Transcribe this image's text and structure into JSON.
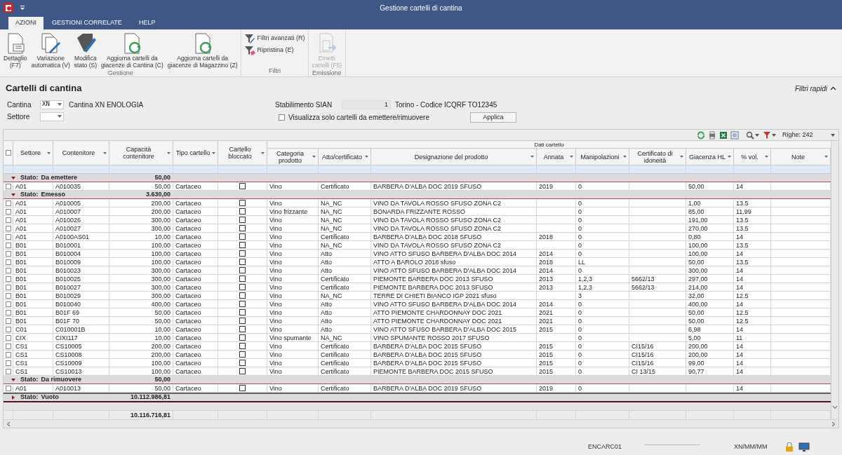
{
  "window": {
    "title": "Gestione cartelli di cantina"
  },
  "ribbon_tabs": [
    {
      "label": "AZIONI",
      "selected": true
    },
    {
      "label": "GESTIONI CORRELATE",
      "selected": false
    },
    {
      "label": "HELP",
      "selected": false
    }
  ],
  "ribbon_groups": [
    {
      "label": "Gestione",
      "buttons": [
        {
          "kind": "large",
          "label": "Dettaglio\n(F7)",
          "disabled": false
        },
        {
          "kind": "large",
          "label": "Variazione\nautomatica (V)",
          "disabled": false
        },
        {
          "kind": "large",
          "label": "Modifica\nstato (S)",
          "disabled": false
        },
        {
          "kind": "large",
          "label": "Aggiorna cartelli da\ngiacenze di Cantina (C)",
          "disabled": false
        },
        {
          "kind": "large",
          "label": "Aggiorna cartelli da\ngiacenze di Magazzino (Z)",
          "disabled": false
        }
      ]
    },
    {
      "label": "Filtri",
      "buttons": [
        {
          "kind": "small",
          "label": "Filtri avanzati (R)",
          "disabled": false
        },
        {
          "kind": "small",
          "label": "Ripristina (E)",
          "disabled": false
        }
      ]
    },
    {
      "label": "Emissione",
      "buttons": [
        {
          "kind": "large",
          "label": "Emetti\ncartelli (F5)",
          "disabled": true
        }
      ]
    }
  ],
  "page": {
    "title": "Cartelli di cantina",
    "quick_filters": {
      "label": "Filtri rapidi",
      "expanded": true
    }
  },
  "filters": {
    "cantina": {
      "label": "Cantina",
      "value": "XN",
      "description": "Cantina XN ENOLOGIA"
    },
    "settore": {
      "label": "Settore"
    },
    "stabilimento": {
      "label": "Stabilimento SIAN",
      "value": "1",
      "description": "Torino - Codice ICQRF TO12345"
    },
    "only_pending": {
      "label": "Visualizza solo cartelli da emettere/rimuovere",
      "checked": false
    },
    "apply_button": "Applica"
  },
  "table": {
    "rows_count": "Righe: 242",
    "select_all": false,
    "group_header": "Dati cartello",
    "columns": [
      "Settore",
      "Contenitore",
      "Capacità contenitore",
      "Tipo cartello",
      "Cartello bloccato",
      "Categoria prodotto",
      "Atto/certificato",
      "Designazione del prodotto",
      "Annata",
      "Manipolazioni",
      "Certificato di idoneità",
      "Giacenza HL",
      "% vol.",
      "Note"
    ],
    "groups": [
      {
        "label": "Stato:",
        "name": "Da emettere",
        "total": "50,00",
        "expanded": true,
        "rows": [
          {
            "selected": false,
            "sector": "A01",
            "container": "A010035",
            "capacity": "50,00",
            "type": "Cartaceo",
            "locked": false,
            "category": "Vino",
            "deed": "Certificato",
            "product": "BARBERA D'ALBA DOC 2019 SFUSO",
            "vintage": "2019",
            "handling": "0",
            "stock_hl": "50,00",
            "abv": "14"
          }
        ]
      },
      {
        "label": "Stato:",
        "name": "Emesso",
        "total": "3.630,00",
        "expanded": true,
        "rows": [
          {
            "selected": false,
            "sector": "A01",
            "container": "A010005",
            "capacity": "200,00",
            "type": "Cartaceo",
            "locked": false,
            "category": "Vino",
            "deed": "NA_NC",
            "product": "VINO DA TAVOLA ROSSO SFUSO ZONA C2",
            "handling": "0",
            "stock_hl": "1,00",
            "abv": "13.5"
          },
          {
            "selected": false,
            "sector": "A01",
            "container": "A010007",
            "capacity": "200,00",
            "type": "Cartaceo",
            "locked": false,
            "category": "Vino frizzante",
            "deed": "NA_NC",
            "product": "BONARDA FRIZZANTE ROSSO",
            "handling": "0",
            "stock_hl": "85,00",
            "abv": "11.99"
          },
          {
            "selected": false,
            "sector": "A01",
            "container": "A010026",
            "capacity": "300,00",
            "type": "Cartaceo",
            "locked": false,
            "category": "Vino",
            "deed": "NA_NC",
            "product": "VINO DA TAVOLA ROSSO SFUSO ZONA C2",
            "handling": "0",
            "stock_hl": "191,00",
            "abv": "13.5"
          },
          {
            "selected": false,
            "sector": "A01",
            "container": "A010027",
            "capacity": "300,00",
            "type": "Cartaceo",
            "locked": false,
            "category": "Vino",
            "deed": "NA_NC",
            "product": "VINO DA TAVOLA ROSSO SFUSO ZONA C2",
            "handling": "0",
            "stock_hl": "270,00",
            "abv": "13.5"
          },
          {
            "selected": false,
            "sector": "A01",
            "container": "A0100AS01",
            "capacity": "10,00",
            "type": "Cartaceo",
            "locked": false,
            "category": "Vino",
            "deed": "Certificato",
            "product": "BARBERA D'ALBA DOC 2018 SFUSO",
            "vintage": "2018",
            "handling": "0",
            "stock_hl": "0,80",
            "abv": "14"
          },
          {
            "selected": false,
            "sector": "B01",
            "container": "B010001",
            "capacity": "100,00",
            "type": "Cartaceo",
            "locked": false,
            "category": "Vino",
            "deed": "NA_NC",
            "product": "VINO DA TAVOLA ROSSO SFUSO ZONA C2",
            "handling": "0",
            "stock_hl": "100,00",
            "abv": "13.5"
          },
          {
            "selected": false,
            "sector": "B01",
            "container": "B010004",
            "capacity": "100,00",
            "type": "Cartaceo",
            "locked": false,
            "category": "Vino",
            "deed": "Atto",
            "product": "VINO ATTO SFUSO BARBERA D'ALBA DOC 2014",
            "vintage": "2014",
            "handling": "0",
            "stock_hl": "100,00",
            "abv": "14"
          },
          {
            "selected": false,
            "sector": "B01",
            "container": "B010009",
            "capacity": "100,00",
            "type": "Cartaceo",
            "locked": false,
            "category": "Vino",
            "deed": "Atto",
            "product": "ATTO A BAROLO 2018 sfuso",
            "vintage": "2018",
            "handling": "LL",
            "stock_hl": "50,00",
            "abv": "13.5"
          },
          {
            "selected": false,
            "sector": "B01",
            "container": "B010023",
            "capacity": "300,00",
            "type": "Cartaceo",
            "locked": false,
            "category": "Vino",
            "deed": "Atto",
            "product": "VINO ATTO SFUSO BARBERA D'ALBA DOC 2014",
            "vintage": "2014",
            "handling": "0",
            "stock_hl": "300,00",
            "abv": "14"
          },
          {
            "selected": false,
            "sector": "B01",
            "container": "B010025",
            "capacity": "300,00",
            "type": "Cartaceo",
            "locked": false,
            "category": "Vino",
            "deed": "Certificato",
            "product": "PIEMONTE BARBERA DOC 2013 SFUSO",
            "vintage": "2013",
            "handling": "1,2,3",
            "certificate": "5662/13",
            "stock_hl": "297,00",
            "abv": "14"
          },
          {
            "selected": false,
            "sector": "B01",
            "container": "B010027",
            "capacity": "300,00",
            "type": "Cartaceo",
            "locked": false,
            "category": "Vino",
            "deed": "Certificato",
            "product": "PIEMONTE BARBERA DOC 2013 SFUSO",
            "vintage": "2013",
            "handling": "1,2,3",
            "certificate": "5662/13",
            "stock_hl": "214,00",
            "abv": "14"
          },
          {
            "selected": false,
            "sector": "B01",
            "container": "B010029",
            "capacity": "300,00",
            "type": "Cartaceo",
            "locked": false,
            "category": "Vino",
            "deed": "NA_NC",
            "product": "TERRE DI CHIETI BIANCO IGP 2021 sfuso",
            "handling": "3",
            "stock_hl": "32,00",
            "abv": "12.5"
          },
          {
            "selected": false,
            "sector": "B01",
            "container": "B010040",
            "capacity": "400,00",
            "type": "Cartaceo",
            "locked": false,
            "category": "Vino",
            "deed": "Atto",
            "product": "VINO ATTO SFUSO BARBERA D'ALBA DOC 2014",
            "vintage": "2014",
            "handling": "0",
            "stock_hl": "400,00",
            "abv": "14"
          },
          {
            "selected": false,
            "sector": "B01",
            "container": "B01F 69",
            "capacity": "50,00",
            "type": "Cartaceo",
            "locked": false,
            "category": "Vino",
            "deed": "Atto",
            "product": "ATTO PIEMONTE CHARDONNAY DOC 2021",
            "vintage": "2021",
            "handling": "0",
            "stock_hl": "50,00",
            "abv": "12.5"
          },
          {
            "selected": false,
            "sector": "B01",
            "container": "B01F 70",
            "capacity": "50,00",
            "type": "Cartaceo",
            "locked": false,
            "category": "Vino",
            "deed": "Atto",
            "product": "ATTO PIEMONTE CHARDONNAY DOC 2021",
            "vintage": "2021",
            "handling": "0",
            "stock_hl": "50,00",
            "abv": "12.5"
          },
          {
            "selected": false,
            "sector": "C01",
            "container": "C010001B",
            "capacity": "10,00",
            "type": "Cartaceo",
            "locked": false,
            "category": "Vino",
            "deed": "Atto",
            "product": "VINO ATTO SFUSO BARBERA D'ALBA DOC 2015",
            "vintage": "2015",
            "handling": "0",
            "stock_hl": "6,98",
            "abv": "14"
          },
          {
            "selected": false,
            "sector": "CIX",
            "container": "CIXI117",
            "capacity": "10,00",
            "type": "Cartaceo",
            "locked": false,
            "category": "Vino spumante",
            "deed": "NA_NC",
            "product": "VINO SPUMANTE ROSSO 2017 SFUSO",
            "handling": "0",
            "stock_hl": "5,00",
            "abv": "11"
          },
          {
            "selected": false,
            "sector": "CS1",
            "container": "CS10005",
            "capacity": "200,00",
            "type": "Cartaceo",
            "locked": false,
            "category": "Vino",
            "deed": "Certificato",
            "product": "BARBERA D'ALBA DOC 2015 SFUSO",
            "vintage": "2015",
            "handling": "0",
            "certificate": "CI15/16",
            "stock_hl": "200,00",
            "abv": "14"
          },
          {
            "selected": false,
            "sector": "CS1",
            "container": "CS10008",
            "capacity": "200,00",
            "type": "Cartaceo",
            "locked": false,
            "category": "Vino",
            "deed": "Certificato",
            "product": "BARBERA D'ALBA DOC 2015 SFUSO",
            "vintage": "2015",
            "handling": "0",
            "certificate": "CI15/16",
            "stock_hl": "200,00",
            "abv": "14"
          },
          {
            "selected": false,
            "sector": "CS1",
            "container": "CS10009",
            "capacity": "100,00",
            "type": "Cartaceo",
            "locked": false,
            "category": "Vino",
            "deed": "Certificato",
            "product": "BARBERA D'ALBA DOC 2015 SFUSO",
            "vintage": "2015",
            "handling": "0",
            "certificate": "CI15/16",
            "stock_hl": "99,00",
            "abv": "14"
          },
          {
            "selected": false,
            "sector": "CS1",
            "container": "CS10013",
            "capacity": "100,00",
            "type": "Cartaceo",
            "locked": false,
            "category": "Vino",
            "deed": "Certificato",
            "product": "PIEMONTE BARBERA DOC 2015 SFUSO",
            "vintage": "2015",
            "handling": "0",
            "certificate": "CI 13/15",
            "stock_hl": "90,77",
            "abv": "14"
          }
        ]
      },
      {
        "label": "Stato:",
        "name": "Da rimuovere",
        "total": "50,00",
        "expanded": true,
        "rows": [
          {
            "selected": false,
            "sector": "A01",
            "container": "A010013",
            "capacity": "50,00",
            "type": "Cartaceo",
            "locked": false,
            "category": "Vino",
            "deed": "Certificato",
            "product": "BARBERA D'ALBA DOC 2019 SFUSO",
            "vintage": "2019",
            "handling": "0",
            "abv": "14"
          }
        ]
      },
      {
        "label": "Stato:",
        "name": "Vuoto",
        "total": "10.112.986,81",
        "expanded": false
      }
    ],
    "grand_total": "10.116.716,81"
  },
  "status_bar": {
    "code": "ENCARC01",
    "date_format": "XN/MM/MM"
  }
}
